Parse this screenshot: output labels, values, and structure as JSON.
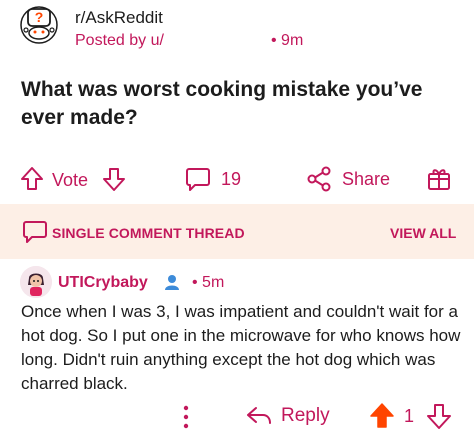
{
  "post": {
    "subreddit": "r/AskReddit",
    "posted_by": "Posted by u/",
    "time": "• 9m",
    "title": "What was worst cooking mistake you’ve ever made?"
  },
  "actions": {
    "vote_label": "Vote",
    "comment_count": "19",
    "share_label": "Share"
  },
  "banner": {
    "label": "SINGLE COMMENT THREAD",
    "view_all": "VIEW ALL"
  },
  "comment": {
    "username": "UTICrybaby",
    "time": "• 5m",
    "body": "Once when I was 3, I was impatient and couldn't wait for a hot dog. So I put one in the microwave for who knows how long. Didn't ruin anything except the hot dog which was charred black.",
    "reply_label": "Reply",
    "score": "1"
  },
  "colors": {
    "accent": "#c2185b",
    "upvote_active": "#ff4500",
    "banner_bg": "#fdefe6"
  },
  "icons": [
    "subreddit-avatar-icon",
    "upvote-icon",
    "downvote-icon",
    "comment-icon",
    "share-icon",
    "award-icon",
    "chat-bubble-icon",
    "user-avatar-icon",
    "online-user-icon",
    "more-vertical-icon",
    "reply-icon"
  ]
}
